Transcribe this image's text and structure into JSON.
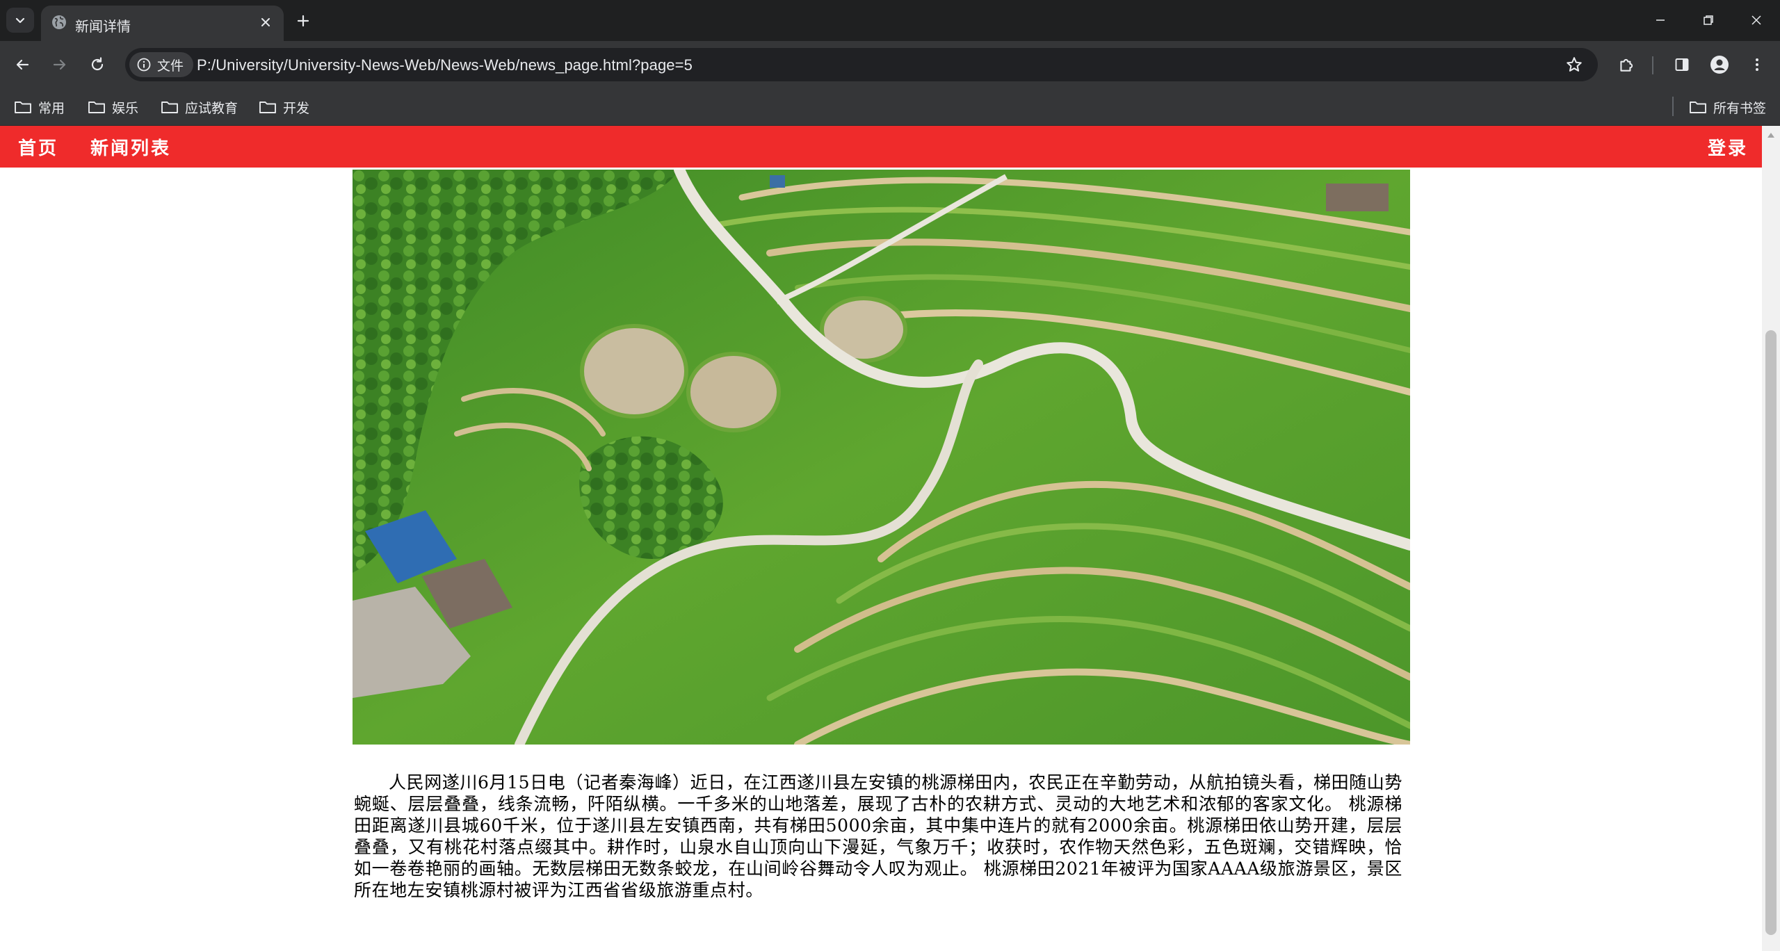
{
  "browser": {
    "tab": {
      "title": "新闻详情",
      "favicon": "globe-icon"
    },
    "address": {
      "security_label": "文件",
      "url": "P:/University/University-News-Web/News-Web/news_page.html?page=5"
    },
    "bookmarks": [
      {
        "label": "常用",
        "icon": "folder-icon"
      },
      {
        "label": "娱乐",
        "icon": "folder-icon"
      },
      {
        "label": "应试教育",
        "icon": "folder-icon"
      },
      {
        "label": "开发",
        "icon": "folder-icon"
      }
    ],
    "all_bookmarks_label": "所有书签"
  },
  "site_nav": {
    "home": "首页",
    "news_list": "新闻列表",
    "login": "登录",
    "bg_color": "#ef2b2b"
  },
  "article": {
    "image": {
      "subject": "aerial photo of terraced rice fields with a winding road"
    },
    "body": "人民网遂川6月15日电（记者秦海峰）近日，在江西遂川县左安镇的桃源梯田内，农民正在辛勤劳动，从航拍镜头看，梯田随山势蜿蜒、层层叠叠，线条流畅，阡陌纵横。一千多米的山地落差，展现了古朴的农耕方式、灵动的大地艺术和浓郁的客家文化。 桃源梯田距离遂川县城60千米，位于遂川县左安镇西南，共有梯田5000余亩，其中集中连片的就有2000余亩。桃源梯田依山势开建，层层叠叠，又有桃花村落点缀其中。耕作时，山泉水自山顶向山下漫延，气象万千；收获时，农作物天然色彩，五色斑斓，交错辉映，恰如一卷卷艳丽的画轴。无数层梯田无数条蛟龙，在山间岭谷舞动令人叹为观止。 桃源梯田2021年被评为国家AAAA级旅游景区，景区所在地左安镇桃源村被评为江西省省级旅游重点村。"
  }
}
